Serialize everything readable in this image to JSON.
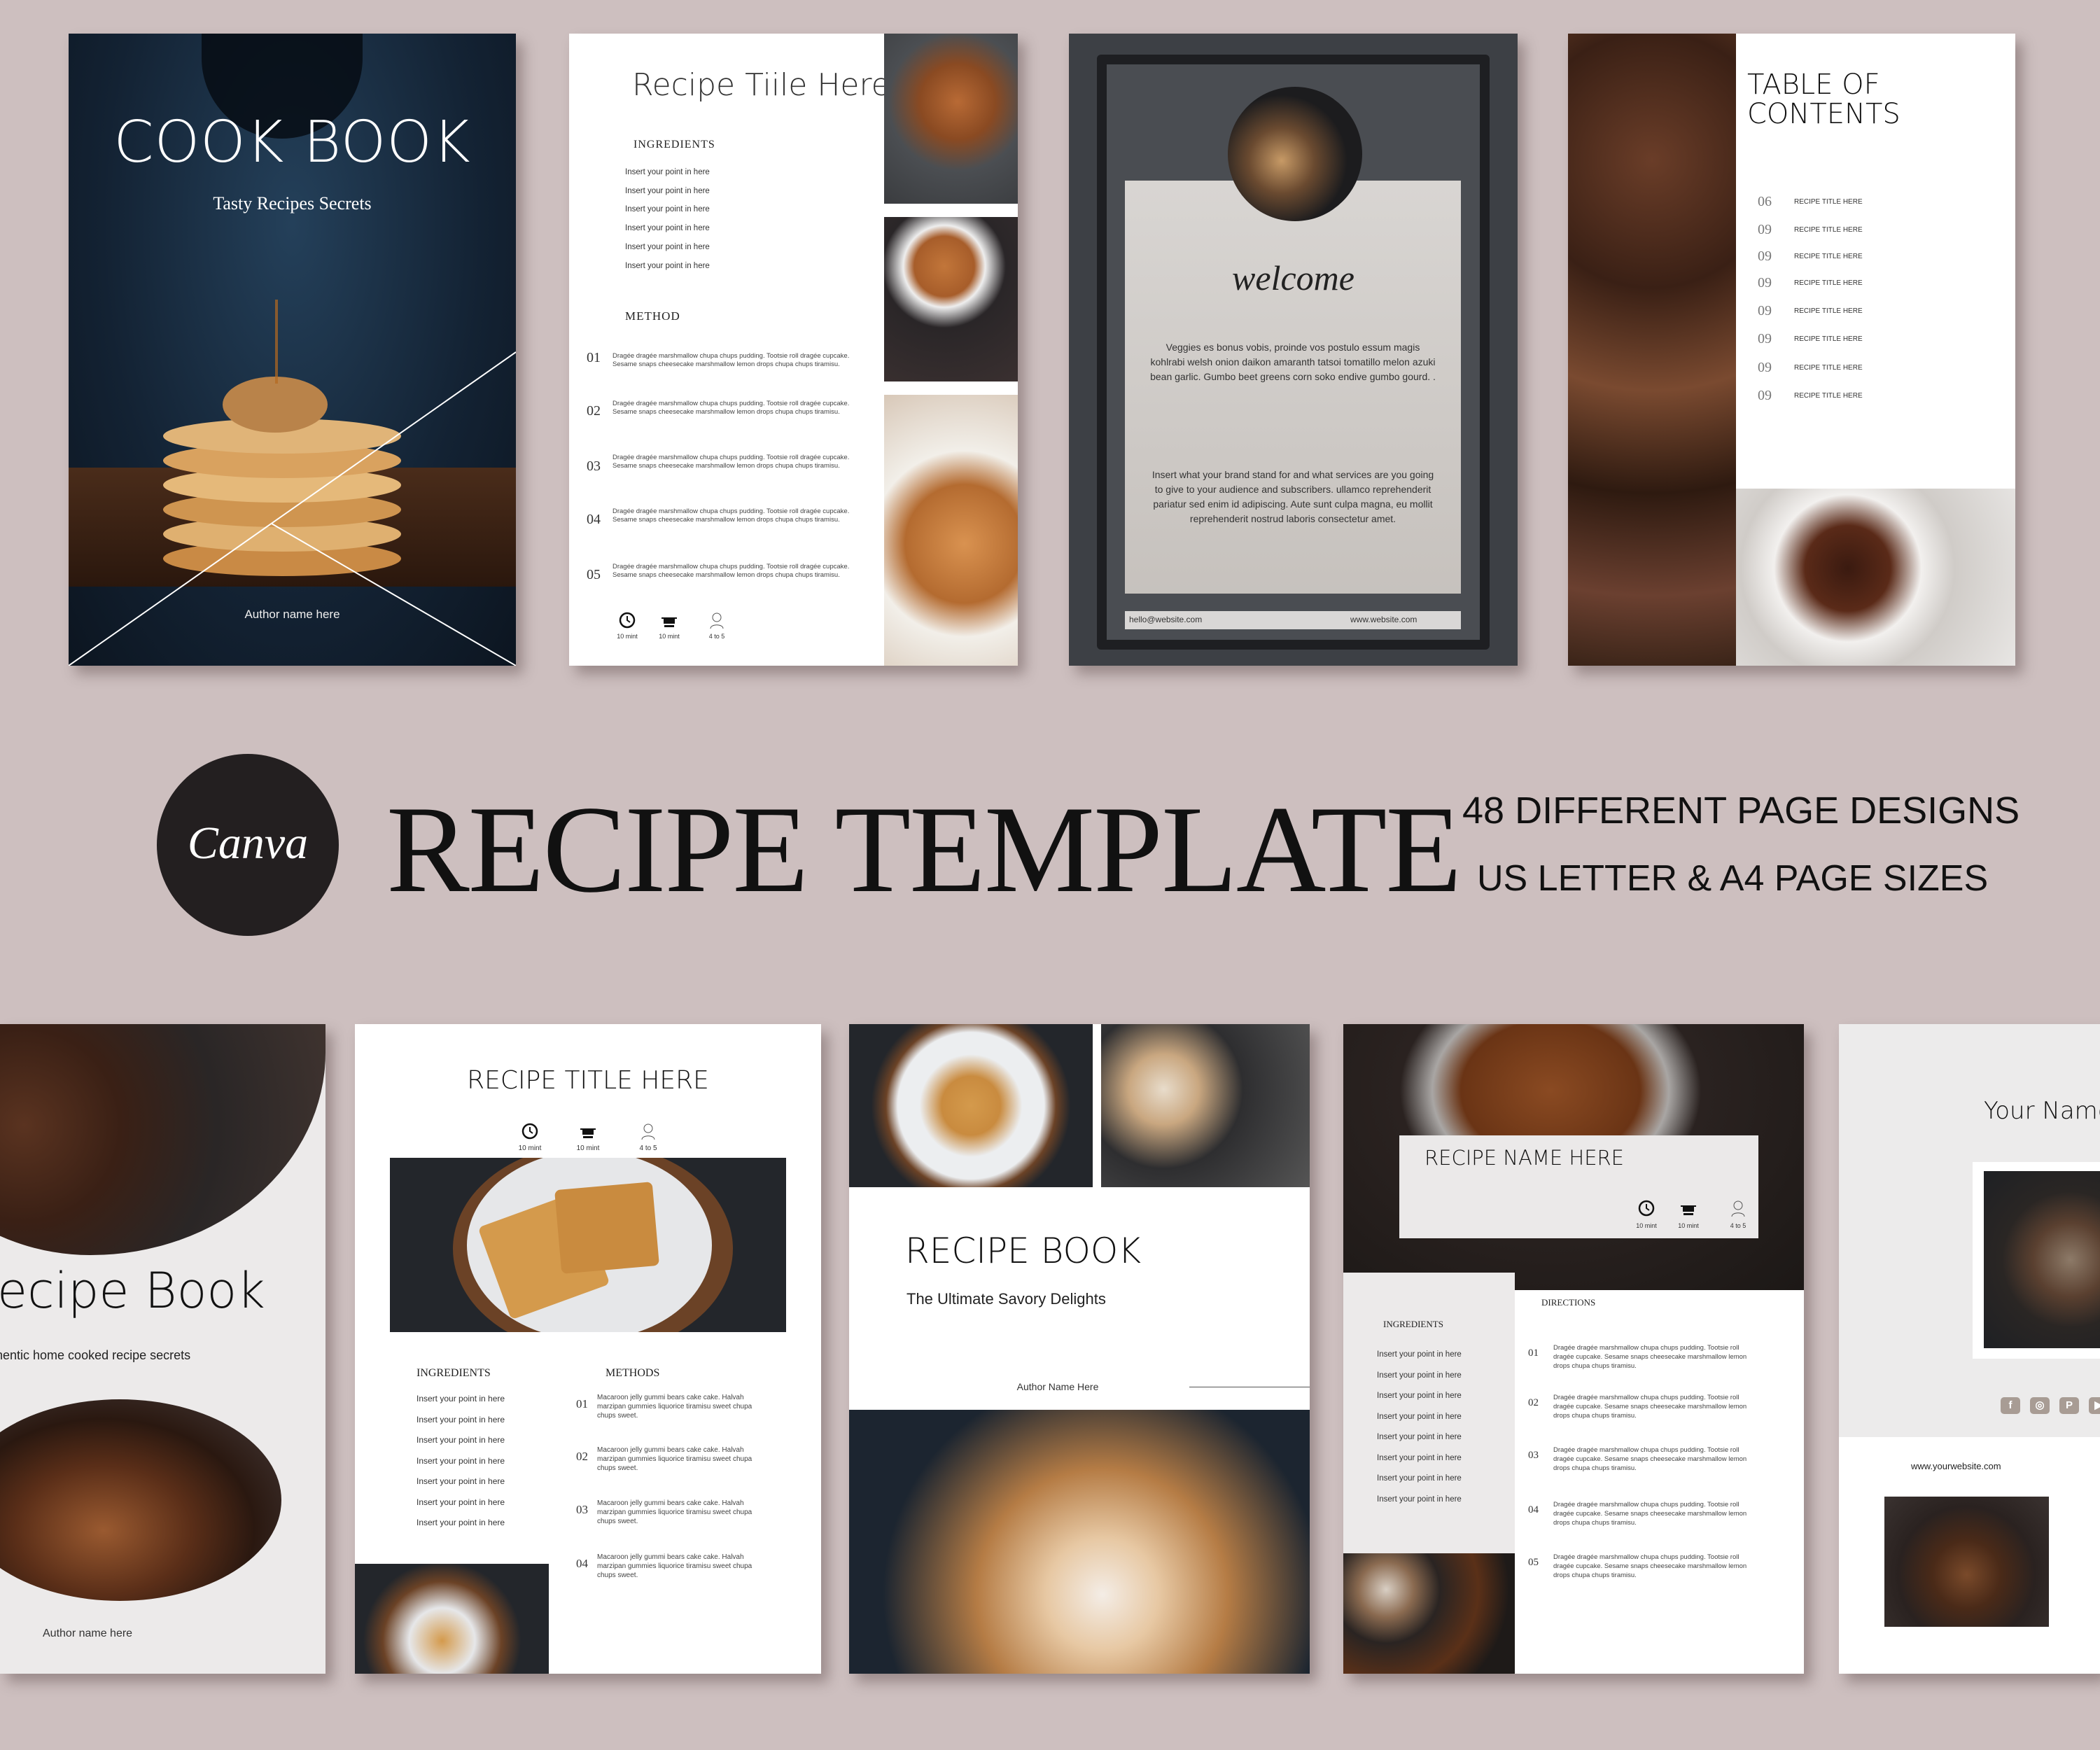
{
  "colors": {
    "background": "#cdbfbf",
    "canva_badge": "#231f20",
    "social_icons": "#a89c94"
  },
  "headline": {
    "logo_text": "Canva",
    "title": "RECIPE TEMPLATE",
    "feature_1": "48 DIFFERENT PAGE DESIGNS",
    "feature_2": "US LETTER & A4 PAGE SIZES"
  },
  "cover": {
    "title": "COOK BOOK",
    "subtitle": "Tasty Recipes Secrets",
    "author": "Author name here"
  },
  "recipe_page": {
    "title": "Recipe Tiile Here",
    "ingredients_heading": "INGREDIENTS",
    "ingredients": [
      "Insert your point in here",
      "Insert your point in here",
      "Insert your point in here",
      "Insert your point in here",
      "Insert your point in here",
      "Insert your point in here"
    ],
    "method_heading": "METHOD",
    "steps": [
      {
        "num": "01",
        "text": "Dragée dragée marshmallow chupa chups pudding. Tootsie roll dragée cupcake. Sesame snaps cheesecake marshmallow lemon drops chupa chups tiramisu."
      },
      {
        "num": "02",
        "text": "Dragée dragée marshmallow chupa chups pudding. Tootsie roll dragée cupcake. Sesame snaps cheesecake marshmallow lemon drops chupa chups tiramisu."
      },
      {
        "num": "03",
        "text": "Dragée dragée marshmallow chupa chups pudding. Tootsie roll dragée cupcake. Sesame snaps cheesecake marshmallow lemon drops chupa chups tiramisu."
      },
      {
        "num": "04",
        "text": "Dragée dragée marshmallow chupa chups pudding. Tootsie roll dragée cupcake. Sesame snaps cheesecake marshmallow lemon drops chupa chups tiramisu."
      },
      {
        "num": "05",
        "text": "Dragée dragée marshmallow chupa chups pudding. Tootsie roll dragée cupcake. Sesame snaps cheesecake marshmallow lemon drops chupa chups tiramisu."
      }
    ],
    "prep": "10 mint",
    "cook": "10 mint",
    "serves": "4 to 5"
  },
  "welcome_page": {
    "script_title": "welcome",
    "paragraph_1": "Veggies es bonus vobis, proinde vos postulo essum magis kohlrabi welsh onion daikon amaranth tatsoi tomatillo melon azuki bean garlic. Gumbo beet greens corn soko endive gumbo gourd. .",
    "paragraph_2": "Insert what your brand stand for and what services are you going to give to your audience and subscribers. ullamco reprehenderit pariatur sed enim id adipiscing. Aute sunt culpa magna, eu mollit reprehenderit nostrud laboris consectetur amet.",
    "email": "hello@website.com",
    "website": "www.website.com"
  },
  "toc_page": {
    "title_line_1": "TABLE OF",
    "title_line_2": "CONTENTS",
    "items": [
      {
        "num": "06",
        "label": "RECIPE TITLE HERE"
      },
      {
        "num": "09",
        "label": "RECIPE TITLE HERE"
      },
      {
        "num": "09",
        "label": "RECIPE TITLE HERE"
      },
      {
        "num": "09",
        "label": "RECIPE TITLE HERE"
      },
      {
        "num": "09",
        "label": "RECIPE TITLE HERE"
      },
      {
        "num": "09",
        "label": "RECIPE TITLE HERE"
      },
      {
        "num": "09",
        "label": "RECIPE TITLE HERE"
      },
      {
        "num": "09",
        "label": "RECIPE TITLE HERE"
      }
    ]
  },
  "recipe_book_cover": {
    "title": "ecipe Book",
    "subtitle": "hentic home cooked recipe secrets",
    "author": "Author name here"
  },
  "waffle_page": {
    "title": "RECIPE TITLE HERE",
    "prep": "10 mint",
    "cook": "10 mint",
    "serves": "4 to 5",
    "ingredients_heading": "INGREDIENTS",
    "ingredients": [
      "Insert your point in here",
      "Insert your point in here",
      "Insert your point in here",
      "Insert your point in here",
      "Insert your point in here",
      "Insert your point in here",
      "Insert your point in here"
    ],
    "methods_heading": "METHODS",
    "steps": [
      {
        "num": "01",
        "text": "Macaroon jelly gummi bears cake cake. Halvah marzipan gummies liquorice tiramisu sweet chupa chups sweet."
      },
      {
        "num": "02",
        "text": "Macaroon jelly gummi bears cake cake. Halvah marzipan gummies liquorice tiramisu sweet chupa chups sweet."
      },
      {
        "num": "03",
        "text": "Macaroon jelly gummi bears cake cake. Halvah marzipan gummies liquorice tiramisu sweet chupa chups sweet."
      },
      {
        "num": "04",
        "text": "Macaroon jelly gummi bears cake cake. Halvah marzipan gummies liquorice tiramisu sweet chupa chups sweet."
      }
    ]
  },
  "book_page": {
    "title": "RECIPE BOOK",
    "subtitle": "The Ultimate Savory Delights",
    "author": "Author Name Here"
  },
  "pie_page": {
    "title": "RECIPE NAME HERE",
    "prep": "10 mint",
    "cook": "10 mint",
    "serves": "4 to 5",
    "ingredients_heading": "INGREDIENTS",
    "ingredients": [
      "Insert your point in here",
      "Insert your point in here",
      "Insert your point in here",
      "Insert your point in here",
      "Insert your point in here",
      "Insert your point in here",
      "Insert your point in here",
      "Insert your point in here"
    ],
    "directions_heading": "DIRECTIONS",
    "steps": [
      {
        "num": "01",
        "text": "Dragée dragée marshmallow chupa chups pudding. Tootsie roll dragée cupcake. Sesame snaps cheesecake marshmallow lemon drops chupa chups tiramisu."
      },
      {
        "num": "02",
        "text": "Dragée dragée marshmallow chupa chups pudding. Tootsie roll dragée cupcake. Sesame snaps cheesecake marshmallow lemon drops chupa chups tiramisu."
      },
      {
        "num": "03",
        "text": "Dragée dragée marshmallow chupa chups pudding. Tootsie roll dragée cupcake. Sesame snaps cheesecake marshmallow lemon drops chupa chups tiramisu."
      },
      {
        "num": "04",
        "text": "Dragée dragée marshmallow chupa chups pudding. Tootsie roll dragée cupcake. Sesame snaps cheesecake marshmallow lemon drops chupa chups tiramisu."
      },
      {
        "num": "05",
        "text": "Dragée dragée marshmallow chupa chups pudding. Tootsie roll dragée cupcake. Sesame snaps cheesecake marshmallow lemon drops chupa chups tiramisu."
      }
    ]
  },
  "about_page": {
    "name": "Your Name",
    "website": "www.yourwebsite.com",
    "social_icons": [
      "facebook-icon",
      "instagram-icon",
      "pinterest-icon",
      "youtube-icon"
    ]
  }
}
